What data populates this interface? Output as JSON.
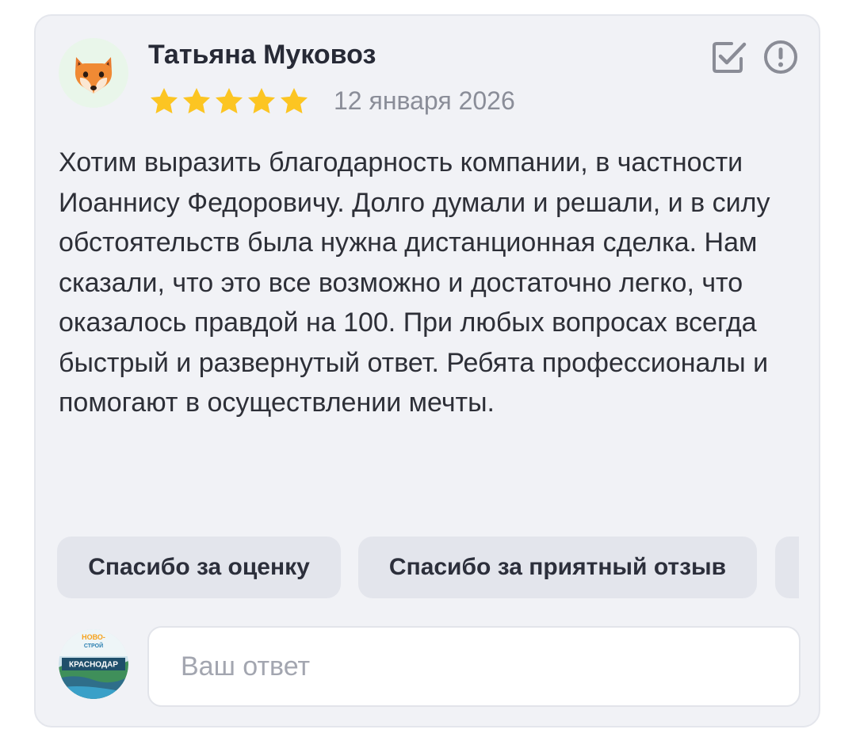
{
  "review": {
    "author_name": "Татьяна Муковоз",
    "rating": 5,
    "rating_max": 5,
    "date": "12 января 2026",
    "avatar_icon": "fox-face-icon",
    "text": "Хотим выразить благодарность компании, в частности Иоаннису Федоровичу. Долго думали и решали, и в силу обстоятельств была нужна дистанционная сделка. Нам сказали, что это все возможно и достаточно легко, что оказалось правдой на 100. При любых вопросах всегда быстрый и развернутый ответ. Ребята профессионалы и помогают в осуществлении мечты."
  },
  "actions": {
    "mark_icon": "checkbox-check-icon",
    "report_icon": "exclamation-circle-icon"
  },
  "quick_replies": [
    "Спасибо за оценку",
    "Спасибо за приятный отзыв"
  ],
  "reply": {
    "placeholder": "Ваш ответ",
    "company_logo": {
      "line1": "НОВО-",
      "line2": "СТРОЙ",
      "line3": "КРАСНОДАР"
    }
  },
  "colors": {
    "card_background": "#f1f2f6",
    "star": "#fcc522",
    "chip_background": "#e3e5ec",
    "icon": "#8a8c96"
  }
}
